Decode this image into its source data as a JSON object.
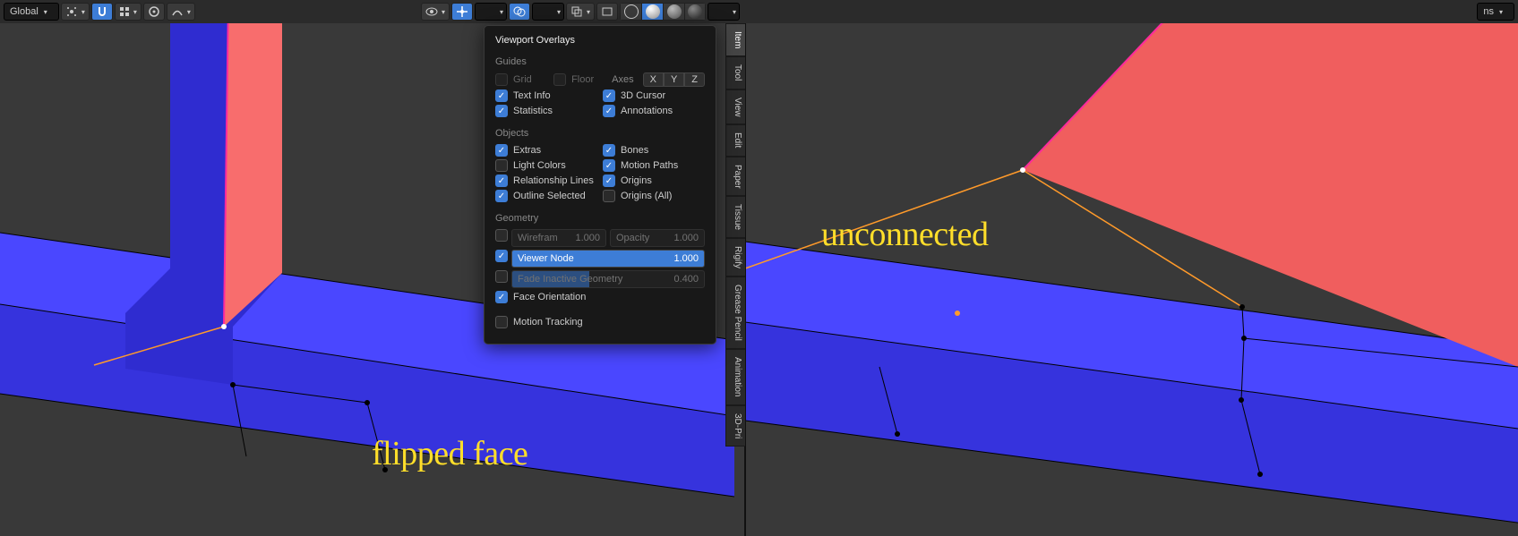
{
  "header": {
    "orientation_label": "Global"
  },
  "header_right_tab": "ns",
  "popover": {
    "title": "Viewport Overlays",
    "sections": {
      "guides": {
        "title": "Guides",
        "grid": "Grid",
        "floor": "Floor",
        "axes_label": "Axes",
        "axes": [
          "X",
          "Y",
          "Z"
        ],
        "text_info": "Text Info",
        "cursor_3d": "3D Cursor",
        "statistics": "Statistics",
        "annotations": "Annotations"
      },
      "objects": {
        "title": "Objects",
        "extras": "Extras",
        "bones": "Bones",
        "light_colors": "Light Colors",
        "motion_paths": "Motion Paths",
        "relationship_lines": "Relationship Lines",
        "origins": "Origins",
        "outline_selected": "Outline Selected",
        "origins_all": "Origins (All)"
      },
      "geometry": {
        "title": "Geometry",
        "wireframe_label": "Wirefram",
        "wireframe_val": "1.000",
        "opacity_label": "Opacity",
        "opacity_val": "1.000",
        "viewer_node_label": "Viewer Node",
        "viewer_node_val": "1.000",
        "fade_label": "Fade Inactive Geometry",
        "fade_val": "0.400",
        "face_orientation": "Face Orientation"
      },
      "motion_tracking": "Motion Tracking"
    }
  },
  "sidetabs": [
    "Item",
    "Tool",
    "View",
    "Edit",
    "Paper",
    "Tissue",
    "Rigify",
    "Grease Pencil",
    "Animation",
    "3D-Pri"
  ],
  "annotations": {
    "left": "flipped face",
    "right": "unconnected"
  }
}
